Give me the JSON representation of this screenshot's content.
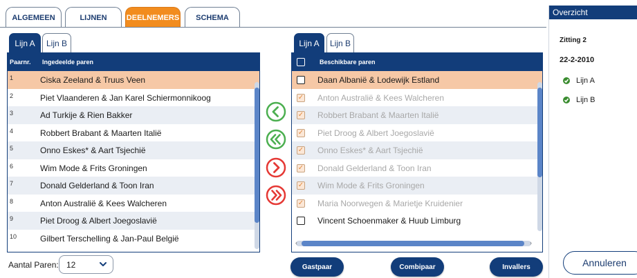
{
  "top_tabs": [
    {
      "label": "ALGEMEEN",
      "active": false
    },
    {
      "label": "LIJNEN",
      "active": false
    },
    {
      "label": "DEELNEMERS",
      "active": true
    },
    {
      "label": "SCHEMA",
      "active": false
    }
  ],
  "left": {
    "tabs": [
      {
        "label": "Lijn A",
        "active": true
      },
      {
        "label": "Lijn B",
        "active": false
      }
    ],
    "header_num": "Paarnr.",
    "header_name": "Ingedeelde paren",
    "rows": [
      {
        "num": "1",
        "name": "Ciska Zeeland & Truus Veen",
        "selected": true
      },
      {
        "num": "2",
        "name": "Piet Vlaanderen & Jan Karel Schiermonnikoog"
      },
      {
        "num": "3",
        "name": "Ad Turkije & Rien Bakker"
      },
      {
        "num": "4",
        "name": "Robbert Brabant & Maarten Italië"
      },
      {
        "num": "5",
        "name": "Onno Eskes* & Aart Tsjechië"
      },
      {
        "num": "6",
        "name": "Wim Mode & Frits Groningen"
      },
      {
        "num": "7",
        "name": "Donald Gelderland & Toon Iran"
      },
      {
        "num": "8",
        "name": "Anton Australië & Kees Walcheren"
      },
      {
        "num": "9",
        "name": "Piet Droog & Albert Joegoslavië"
      },
      {
        "num": "10",
        "name": "Gilbert Terschelling & Jan-Paul België"
      }
    ]
  },
  "right": {
    "tabs": [
      {
        "label": "Lijn A",
        "active": true
      },
      {
        "label": "Lijn B",
        "active": false
      }
    ],
    "header_name": "Beschikbare paren",
    "rows": [
      {
        "name": "Daan Albanië & Lodewijk Estland",
        "checked": false,
        "disabled": false,
        "selected": true
      },
      {
        "name": "Anton Australië & Kees Walcheren",
        "checked": true,
        "disabled": true
      },
      {
        "name": "Robbert Brabant & Maarten Italië",
        "checked": true,
        "disabled": true
      },
      {
        "name": "Piet Droog & Albert Joegoslavië",
        "checked": true,
        "disabled": true
      },
      {
        "name": "Onno Eskes* & Aart Tsjechië",
        "checked": true,
        "disabled": true
      },
      {
        "name": "Donald Gelderland & Toon Iran",
        "checked": true,
        "disabled": true
      },
      {
        "name": "Wim Mode & Frits Groningen",
        "checked": true,
        "disabled": true
      },
      {
        "name": "Maria Noorwegen & Marietje Kruidenier",
        "checked": true,
        "disabled": true
      },
      {
        "name": "Vincent Schoenmaker & Huub Limburg",
        "checked": false,
        "disabled": false
      }
    ]
  },
  "arrows": [
    {
      "name": "move-left-button",
      "icon": "chevron-left-icon",
      "color": "#4caf50"
    },
    {
      "name": "move-all-left-button",
      "icon": "double-chevron-left-icon",
      "color": "#4caf50"
    },
    {
      "name": "move-right-button",
      "icon": "chevron-right-icon",
      "color": "#e53935"
    },
    {
      "name": "move-all-right-button",
      "icon": "double-chevron-right-icon",
      "color": "#e53935"
    }
  ],
  "bottom": {
    "pairs_label": "Aantal Paren:",
    "pairs_value": "12",
    "buttons": [
      "Gastpaar",
      "Combipaar",
      "Invallers"
    ]
  },
  "overview": {
    "title": "Overzicht",
    "session": "Zitting 2",
    "date": "22-2-2010",
    "lines": [
      "Lijn A",
      "Lijn B"
    ],
    "cancel_label": "Annuleren"
  },
  "colors": {
    "accent": "#f28c1e",
    "primary": "#123d7a",
    "selected_row": "#f6c8a6",
    "ok": "#3a8c2f"
  }
}
